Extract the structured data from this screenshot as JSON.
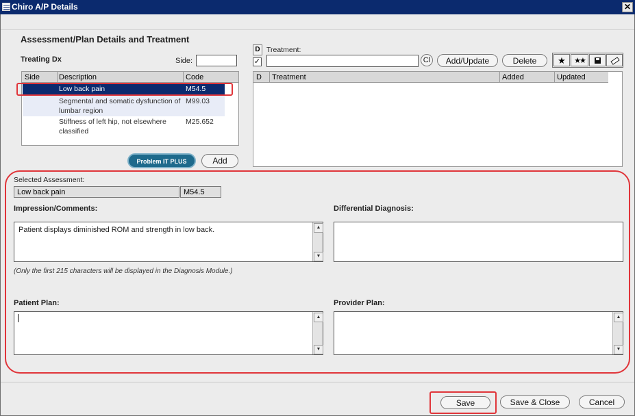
{
  "window": {
    "title": "Chiro A/P Details",
    "close_glyph": "✕"
  },
  "section_title": "Assessment/Plan Details and Treatment",
  "treating_dx": {
    "label": "Treating Dx",
    "side_label": "Side:",
    "side_value": "",
    "columns": [
      "Side",
      "Description",
      "Code"
    ],
    "rows": [
      {
        "side": "",
        "description": "Low back pain",
        "code": "M54.5",
        "selected": true
      },
      {
        "side": "",
        "description": "Segmental and somatic dysfunction of lumbar region",
        "code": "M99.03",
        "selected": false
      },
      {
        "side": "",
        "description": "Stiffness of left hip, not elsewhere classified",
        "code": "M25.652",
        "selected": false
      }
    ],
    "problem_it_plus": "Problem IT PLUS",
    "add_button": "Add"
  },
  "treatment": {
    "d_button": "D",
    "checkbox_checked": true,
    "label": "Treatment:",
    "value": "",
    "clear_button": "Cl",
    "add_update_button": "Add/Update",
    "delete_button": "Delete",
    "toolbar_icons": [
      "star-icon",
      "double-star-icon",
      "save-icon",
      "eraser-icon"
    ],
    "columns": [
      "D",
      "Treatment",
      "Added",
      "Updated"
    ],
    "rows": []
  },
  "assessment": {
    "selected_label": "Selected Assessment:",
    "selected_description": "Low back pain",
    "selected_code": "M54.5",
    "impression_label": "Impression/Comments:",
    "impression_value": "Patient displays diminished ROM and strength in low back.",
    "impression_note": "(Only the first 215 characters will be displayed in the Diagnosis Module.)",
    "differential_label": "Differential Diagnosis:",
    "differential_value": "",
    "patient_plan_label": "Patient Plan:",
    "patient_plan_value": "",
    "provider_plan_label": "Provider Plan:",
    "provider_plan_value": ""
  },
  "footer": {
    "save_button": "Save",
    "save_close_button": "Save & Close",
    "cancel_button": "Cancel"
  },
  "colors": {
    "titlebar": "#0b2a6e",
    "selection": "#0b2a6e",
    "highlight_border": "#e0353a"
  }
}
